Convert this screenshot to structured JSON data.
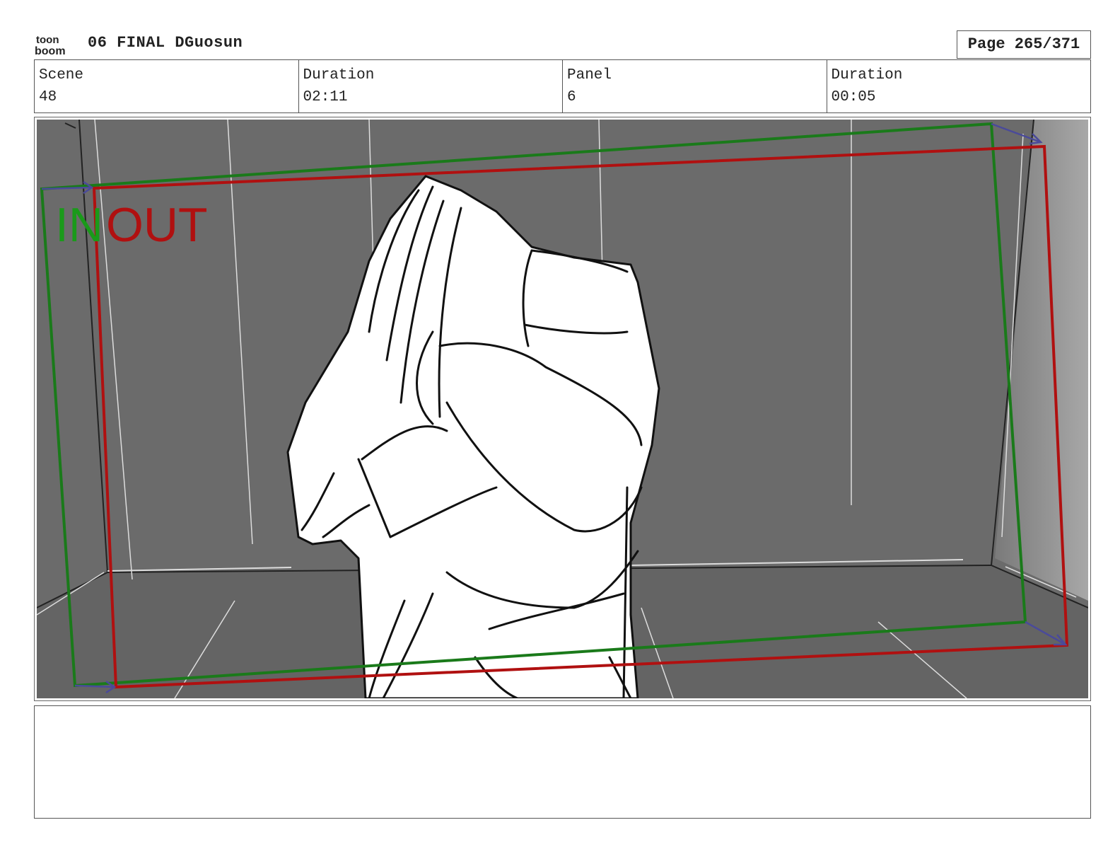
{
  "header": {
    "logo": {
      "line1": "toon",
      "line2": "boom"
    },
    "title": "06 FINAL DGuosun",
    "page": "Page 265/371"
  },
  "info": {
    "scene_label": "Scene",
    "scene_value": "48",
    "scene_duration_label": "Duration",
    "scene_duration_value": "02:11",
    "panel_label": "Panel",
    "panel_value": "6",
    "panel_duration_label": "Duration",
    "panel_duration_value": "00:05"
  },
  "panel": {
    "in_label": "IN",
    "out_label": "OUT",
    "colors": {
      "background": "#6b6b6b",
      "in_frame": "#1a7a1a",
      "out_frame": "#b01010",
      "arrows": "#4a4a9a"
    }
  },
  "notes": {
    "text": ""
  }
}
